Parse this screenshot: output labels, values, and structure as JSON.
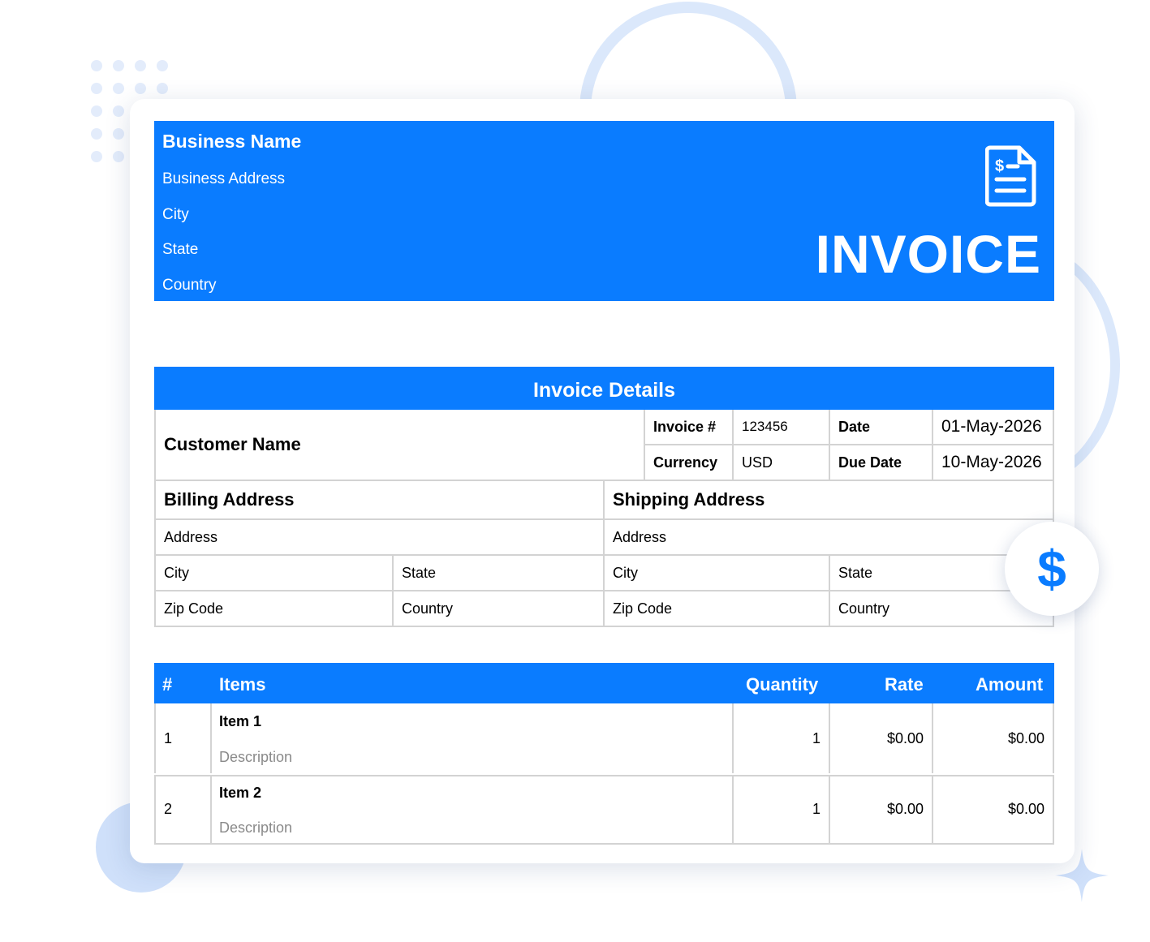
{
  "header": {
    "business_name": "Business Name",
    "address": "Business Address",
    "city": "City",
    "state": "State",
    "country": "Country",
    "title": "INVOICE"
  },
  "details": {
    "title": "Invoice Details",
    "customer_name": "Customer Name",
    "invoice_no_label": "Invoice #",
    "invoice_no": "123456",
    "date_label": "Date",
    "date": "01-May-2026",
    "currency_label": "Currency",
    "currency": "USD",
    "due_date_label": "Due Date",
    "due_date": "10-May-2026"
  },
  "billing": {
    "title": "Billing Address",
    "address": "Address",
    "city": "City",
    "state": "State",
    "zip": "Zip Code",
    "country": "Country"
  },
  "shipping": {
    "title": "Shipping Address",
    "address": "Address",
    "city": "City",
    "state": "State",
    "zip": "Zip Code",
    "country": "Country"
  },
  "items": {
    "headers": {
      "num": "#",
      "items": "Items",
      "quantity": "Quantity",
      "rate": "Rate",
      "amount": "Amount"
    },
    "rows": [
      {
        "num": "1",
        "name": "Item 1",
        "description": "Description",
        "quantity": "1",
        "rate": "$0.00",
        "amount": "$0.00"
      },
      {
        "num": "2",
        "name": "Item 2",
        "description": "Description",
        "quantity": "1",
        "rate": "$0.00",
        "amount": "$0.00"
      }
    ]
  },
  "colors": {
    "accent": "#0a7cff",
    "border": "#d3d3d3",
    "muted_text": "#8a8a8a",
    "decor": "#dbe8fb"
  },
  "icons": {
    "document": "invoice-document-icon",
    "badge": "dollar-sign-icon"
  }
}
